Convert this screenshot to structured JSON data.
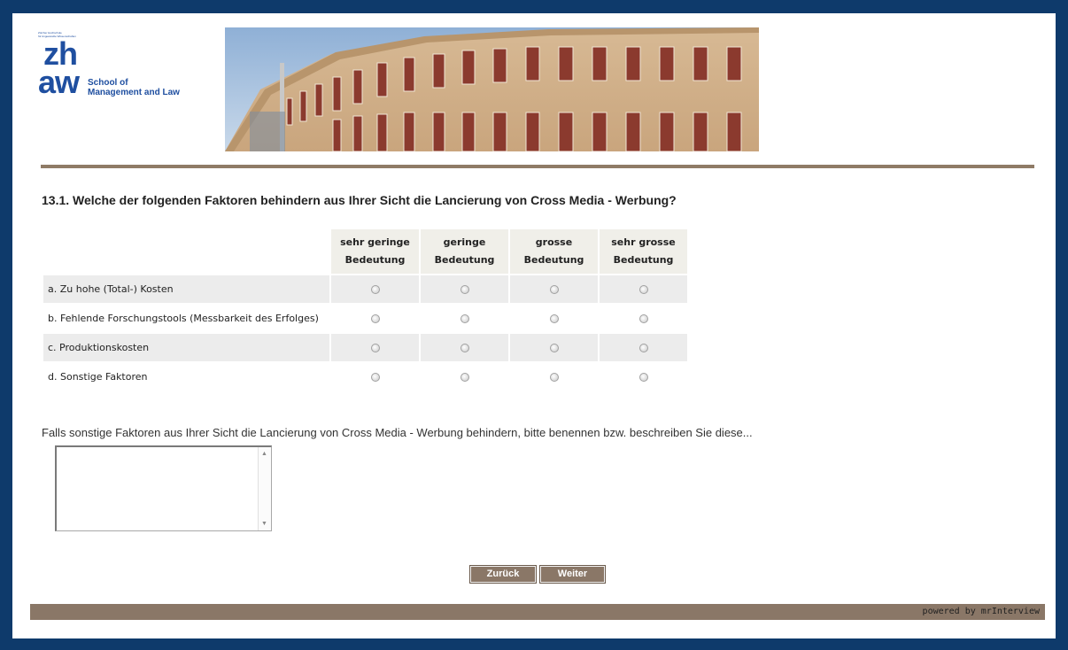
{
  "header": {
    "logo_small_text": "Zürcher Hochschule\nfür Angewandte Wissenschaften",
    "logo_zh": "zh",
    "logo_aw": "aw",
    "logo_school": "School of\nManagement and Law"
  },
  "question": {
    "title": "13.1. Welche der folgenden Faktoren behindern aus Ihrer Sicht die Lancierung von Cross Media - Werbung?",
    "columns": [
      "sehr geringe\nBedeutung",
      "geringe\nBedeutung",
      "grosse\nBedeutung",
      "sehr grosse\nBedeutung"
    ],
    "rows": [
      "a. Zu hohe (Total-) Kosten",
      "b. Fehlende Forschungstools (Messbarkeit des Erfolges)",
      "c. Produktionskosten",
      "d. Sonstige Faktoren"
    ]
  },
  "other": {
    "prompt": "Falls sonstige Faktoren aus Ihrer Sicht die Lancierung von Cross Media - Werbung behindern, bitte benennen bzw. beschreiben Sie diese...",
    "value": ""
  },
  "nav": {
    "back_label": "Zurück",
    "next_label": "Weiter"
  },
  "footer": {
    "powered": "powered by mrInterview"
  },
  "colors": {
    "frame": "#0e3a6b",
    "accent_brown": "#8a7767",
    "logo_blue": "#1f4fa0"
  }
}
